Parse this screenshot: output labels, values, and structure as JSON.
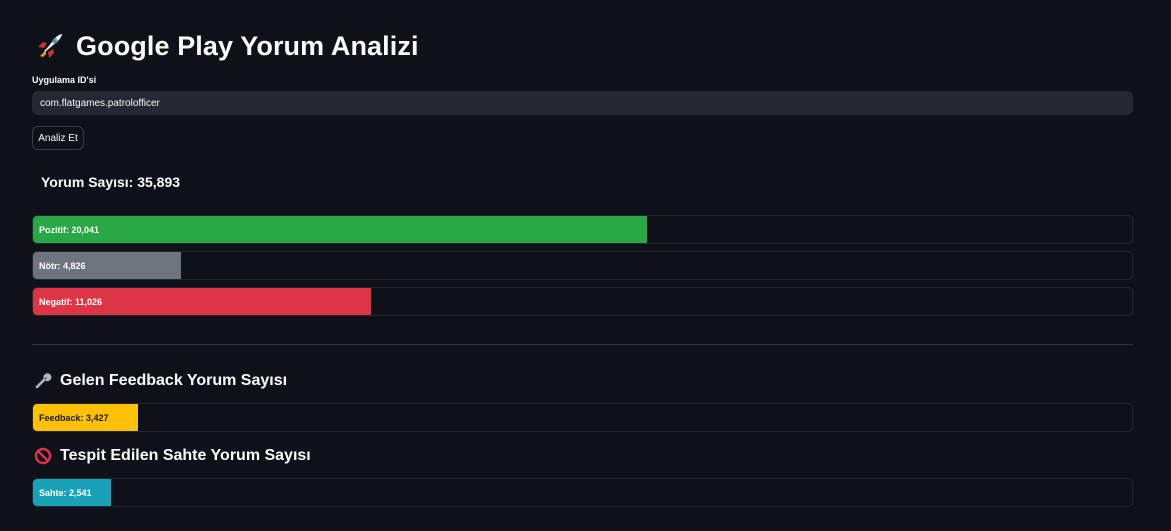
{
  "header": {
    "title": "Google Play Yorum Analizi",
    "icon": "rocket-icon"
  },
  "form": {
    "label": "Uygulama ID'si",
    "app_id": "com.flatgames.patrolofficer",
    "button_label": "Analiz Et"
  },
  "summary": {
    "heading": "Yorum Sayısı: 35,893",
    "total": 35893
  },
  "sentiment_bars": [
    {
      "label": "Pozitif: 20,041",
      "value": 20041,
      "color": "#28a745",
      "text_color": "#ffffff"
    },
    {
      "label": "Nötr: 4,826",
      "value": 4826,
      "color": "#6c757d",
      "text_color": "#ffffff"
    },
    {
      "label": "Negatif: 11,026",
      "value": 11026,
      "color": "#dc3545",
      "text_color": "#ffffff"
    }
  ],
  "feedback": {
    "heading": "Gelen Feedback Yorum Sayısı",
    "icon": "wrench-icon",
    "bar": {
      "label": "Feedback: 3,427",
      "value": 3427,
      "color": "#ffc107",
      "text_color": "#1a1a1a"
    }
  },
  "fake": {
    "heading": "Tespit Edilen Sahte Yorum Sayısı",
    "icon": "prohibited-icon",
    "bar": {
      "label": "Sahte: 2,541",
      "value": 2541,
      "color": "#17a2b8",
      "text_color": "#ffffff"
    }
  }
}
